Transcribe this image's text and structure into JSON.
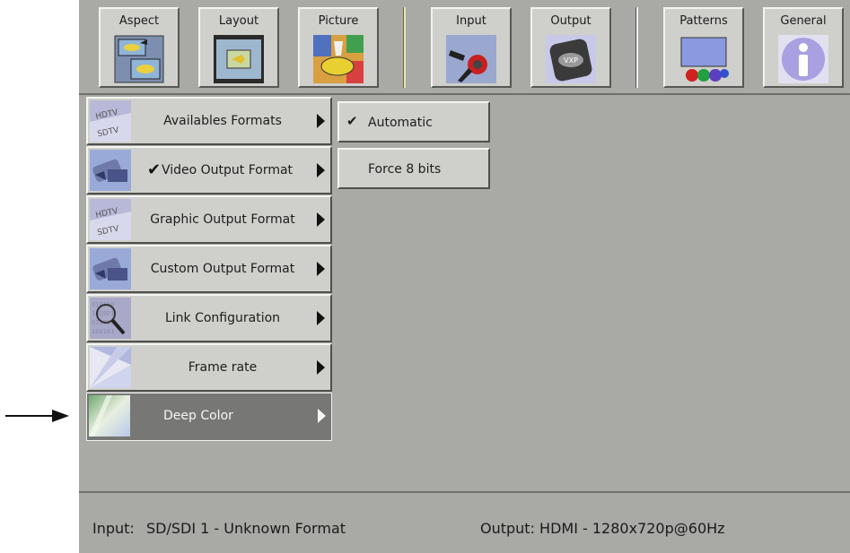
{
  "toolbar": {
    "buttons": [
      {
        "label": "Aspect",
        "icon": "aspect-icon"
      },
      {
        "label": "Layout",
        "icon": "layout-icon"
      },
      {
        "label": "Picture",
        "icon": "picture-icon"
      },
      {
        "label": "Input",
        "icon": "input-connector-icon"
      },
      {
        "label": "Output",
        "icon": "output-vxp-icon"
      },
      {
        "label": "Patterns",
        "icon": "patterns-icon"
      },
      {
        "label": "General",
        "icon": "info-icon"
      }
    ]
  },
  "menu": {
    "items": [
      {
        "label": "Availables Formats",
        "icon": "hdtv-sdtv-icon",
        "checked": false
      },
      {
        "label": "Video Output Format",
        "icon": "video-output-icon",
        "checked": true
      },
      {
        "label": "Graphic Output Format",
        "icon": "hdtv-sdtv-icon",
        "checked": false
      },
      {
        "label": "Custom Output Format",
        "icon": "video-output-icon",
        "checked": false
      },
      {
        "label": "Link Configuration",
        "icon": "magnifier-binary-icon",
        "checked": false
      },
      {
        "label": "Frame rate",
        "icon": "frame-rate-icon",
        "checked": false
      },
      {
        "label": "Deep Color",
        "icon": "deep-color-icon",
        "checked": false,
        "active": true
      }
    ],
    "check_glyph": "✔"
  },
  "submenu": {
    "items": [
      {
        "label": "Automatic",
        "checked": true
      },
      {
        "label": "Force 8 bits",
        "checked": false
      }
    ],
    "check_glyph": "✔"
  },
  "status": {
    "input_label": "Input:",
    "input_value": "SD/SDI 1 - Unknown Format",
    "output_text": "Output: HDMI - 1280x720p@60Hz"
  },
  "colors": {
    "background": "#a9a9a6",
    "button_face": "#cfcfcb",
    "active_item": "#777775"
  }
}
